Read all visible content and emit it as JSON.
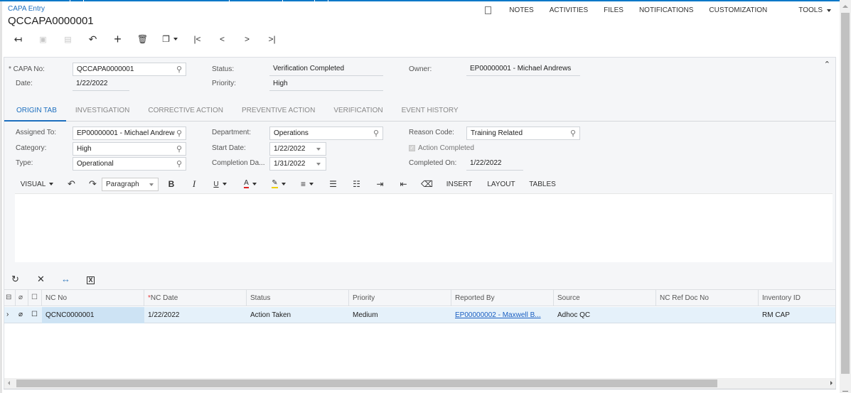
{
  "header": {
    "breadcrumb": "CAPA Entry",
    "title": "QCCAPA0000001"
  },
  "toolbar": {
    "buttons": [
      {
        "name": "back",
        "glyph": "↤"
      },
      {
        "name": "save-close",
        "glyph": "⎘"
      },
      {
        "name": "save",
        "glyph": "🖫"
      },
      {
        "name": "undo",
        "glyph": "↶"
      },
      {
        "name": "add",
        "glyph": "+"
      },
      {
        "name": "delete",
        "glyph": "🗑"
      },
      {
        "name": "copy-paste",
        "glyph": "❐"
      },
      {
        "name": "first",
        "glyph": "|<"
      },
      {
        "name": "previous",
        "glyph": "<"
      },
      {
        "name": "next",
        "glyph": ">"
      },
      {
        "name": "last",
        "glyph": ">|"
      }
    ]
  },
  "top_menu": {
    "notes": "NOTES",
    "activities": "ACTIVITIES",
    "files": "FILES",
    "notifications": "NOTIFICATIONS",
    "customization": "CUSTOMIZATION",
    "tools": "TOOLS"
  },
  "summary": {
    "capa_no_label": "CAPA No:",
    "capa_no_value": "QCCAPA0000001",
    "date_label": "Date:",
    "date_value": "1/22/2022",
    "status_label": "Status:",
    "status_value": "Verification Completed",
    "priority_label": "Priority:",
    "priority_value": "High",
    "owner_label": "Owner:",
    "owner_value": "EP00000001 - Michael Andrews"
  },
  "tabs": [
    {
      "label": "ORIGIN TAB",
      "active": true
    },
    {
      "label": "INVESTIGATION",
      "active": false
    },
    {
      "label": "CORRECTIVE ACTION",
      "active": false
    },
    {
      "label": "PREVENTIVE ACTION",
      "active": false
    },
    {
      "label": "VERIFICATION",
      "active": false
    },
    {
      "label": "EVENT HISTORY",
      "active": false
    }
  ],
  "origin": {
    "assigned_to_label": "Assigned To:",
    "assigned_to_value": "EP00000001 - Michael Andrews",
    "category_label": "Category:",
    "category_value": "High",
    "type_label": "Type:",
    "type_value": "Operational",
    "department_label": "Department:",
    "department_value": "Operations",
    "start_date_label": "Start Date:",
    "start_date_value": "1/22/2022",
    "completion_date_label": "Completion Da...",
    "completion_date_value": "1/31/2022",
    "reason_code_label": "Reason Code:",
    "reason_code_value": "Training Related",
    "action_completed_label": "Action Completed",
    "action_completed_checked": true,
    "completed_on_label": "Completed On:",
    "completed_on_value": "1/22/2022"
  },
  "editor": {
    "visual": "VISUAL",
    "paragraph": "Paragraph",
    "bold": "B",
    "italic": "I",
    "underline": "U",
    "font_color": "A",
    "insert": "INSERT",
    "layout": "LAYOUT",
    "tables": "TABLES",
    "content": ""
  },
  "grid": {
    "columns": [
      "NC No",
      "NC Date",
      "Status",
      "Priority",
      "Reported By",
      "Source",
      "NC Ref Doc No",
      "Inventory ID"
    ],
    "required_column": "NC Date",
    "rows": [
      {
        "nc_no": "QCNC0000001",
        "nc_date": "1/22/2022",
        "status": "Action Taken",
        "priority": "Medium",
        "reported_by": "EP00000002 - Maxwell B...",
        "source": "Adhoc QC",
        "nc_ref_doc_no": "",
        "inventory_id": "RM CAP"
      }
    ]
  }
}
